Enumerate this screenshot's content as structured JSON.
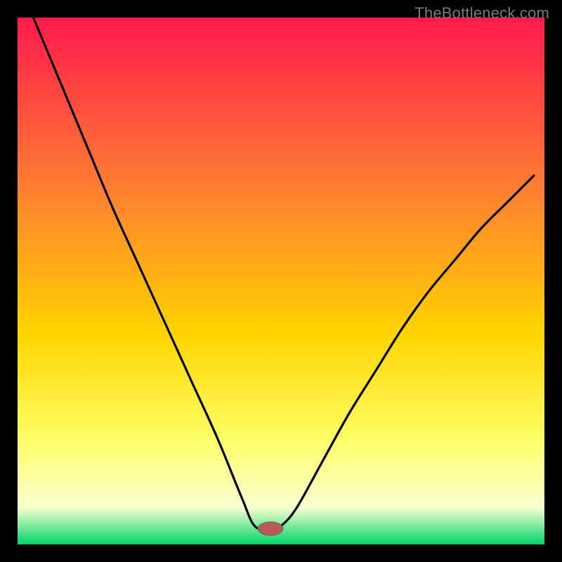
{
  "watermark": "TheBottleneck.com",
  "chart_data": {
    "type": "line",
    "title": "",
    "xlabel": "",
    "ylabel": "",
    "xlim": [
      0,
      100
    ],
    "ylim": [
      0,
      100
    ],
    "series": [
      {
        "name": "bottleneck-curve",
        "color": "#000000",
        "x": [
          3,
          8,
          13,
          18,
          23,
          28,
          33,
          38,
          42.5,
          45,
          48,
          50,
          53,
          58,
          63,
          68,
          73,
          78,
          83,
          88,
          93,
          98
        ],
        "y": [
          100,
          88,
          76,
          64,
          53,
          42,
          31,
          20,
          9,
          3.5,
          3,
          3.5,
          7,
          16,
          25,
          33,
          41,
          48,
          54,
          60,
          65,
          70
        ]
      }
    ],
    "marker": {
      "name": "optimal-point",
      "x": 48,
      "y": 3,
      "rx": 2.4,
      "ry": 1.3,
      "color": "#b85a5a"
    },
    "background_gradient": {
      "top": "#ff1a4d",
      "mid1": "#ff8030",
      "mid2": "#ffd400",
      "mid3": "#ffff66",
      "mid4": "#f8ffd0",
      "bottom": "#00d56a"
    }
  }
}
